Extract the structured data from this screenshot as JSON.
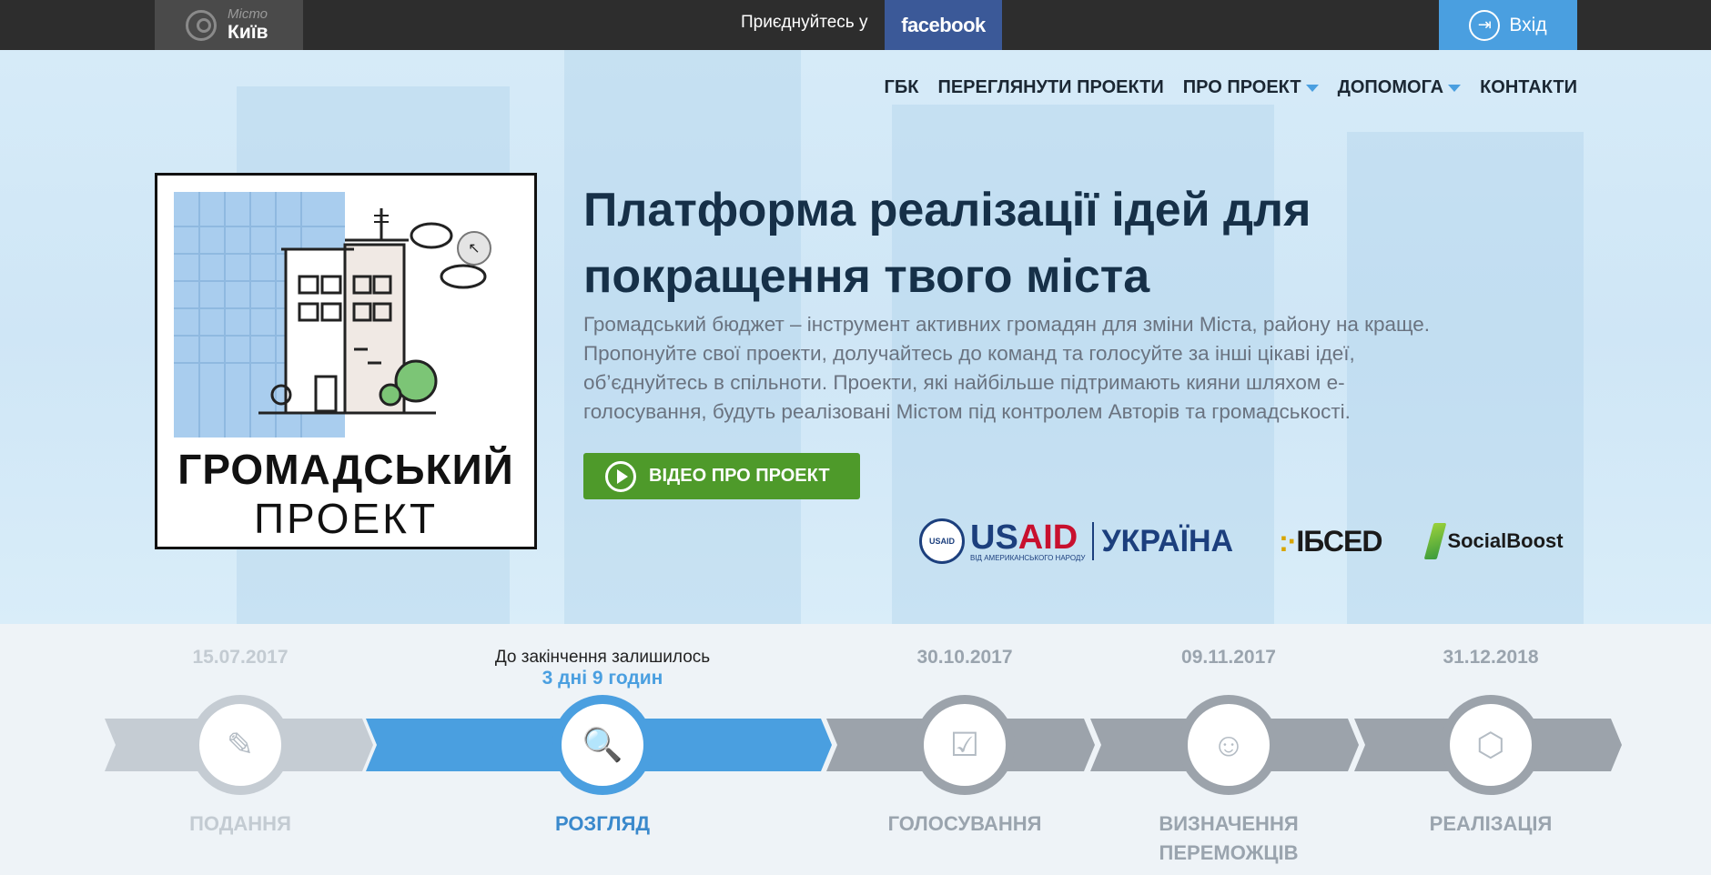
{
  "topbar": {
    "city_label": "Місто",
    "city_name": "Київ",
    "join_text": "Приєднуйтесь у",
    "facebook_label": "facebook",
    "login_label": "Вхід"
  },
  "nav": {
    "items": [
      {
        "label": "ГБК"
      },
      {
        "label": "ПЕРЕГЛЯНУТИ ПРОЕКТИ"
      },
      {
        "label": "ПРО ПРОЕКТ"
      },
      {
        "label": "ДОПОМОГА"
      },
      {
        "label": "КОНТАКТИ"
      }
    ]
  },
  "logo": {
    "line1": "ГРОМАДСЬКИЙ",
    "line2": "ПРОЕКТ"
  },
  "hero": {
    "title_line1": "Платформа реалізації ідей для",
    "title_line2": "покращення твого міста",
    "desc_line1": "Громадський бюджет – інструмент активних громадян для зміни Міста, району на краще.",
    "desc_line2": "Пропонуйте свої проекти, долучайтесь до команд та голосуйте за інші цікаві ідеї,",
    "desc_line3": "об’єднуйтесь в спільноти. Проекти, які найбільше підтримають кияни шляхом е-",
    "desc_line4": "голосування, будуть реалізовані Містом під контролем Авторів та громадськості.",
    "video_button": "ВІДЕО ПРО ПРОЕКТ"
  },
  "partners": {
    "usaid_main_blue": "US",
    "usaid_main_red": "AID",
    "usaid_sub": "ВІД АМЕРИКАНСЬКОГО НАРОДУ",
    "usaid_seal": "USAID",
    "usaid_country": "УКРАЇНА",
    "ibsed": "ІБСЕD",
    "socialboost": "SocialBoost"
  },
  "timeline": {
    "remaining_label": "До закінчення залишилось",
    "remaining_value": "3 дні 9 годин",
    "dates": [
      "15.07.2017",
      "30.10.2017",
      "09.11.2017",
      "31.12.2018"
    ],
    "stages": [
      {
        "label": "ПОДАННЯ",
        "state": "done"
      },
      {
        "label": "РОЗГЛЯД",
        "state": "active"
      },
      {
        "label": "ГОЛОСУВАННЯ",
        "state": "upcoming"
      },
      {
        "label_line1": "ВИЗНАЧЕННЯ",
        "label_line2": "ПЕРЕМОЖЦІВ",
        "state": "upcoming"
      },
      {
        "label": "РЕАЛІЗАЦІЯ",
        "state": "upcoming"
      }
    ]
  },
  "colors": {
    "topbar": "#2d2d2d",
    "facebook": "#3b5998",
    "accent_blue": "#4a9fe0",
    "video_green": "#4e9a2a",
    "title_navy": "#163048",
    "timeline_gray": "#9ca3ab"
  }
}
